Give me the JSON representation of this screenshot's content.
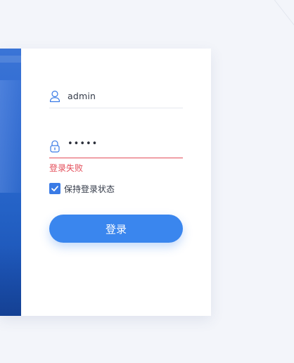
{
  "login": {
    "username": {
      "icon": "user-icon",
      "value": "admin"
    },
    "password": {
      "icon": "lock-icon",
      "masked_value": "•••••"
    },
    "error_message": "登录失败",
    "remember_me": {
      "label": "保持登录状态",
      "checked": true
    },
    "submit_label": "登录"
  },
  "colors": {
    "accent": "#3a86ee",
    "error": "#e34d59",
    "side_image": "#2462c6",
    "background": "#f3f5fa"
  }
}
